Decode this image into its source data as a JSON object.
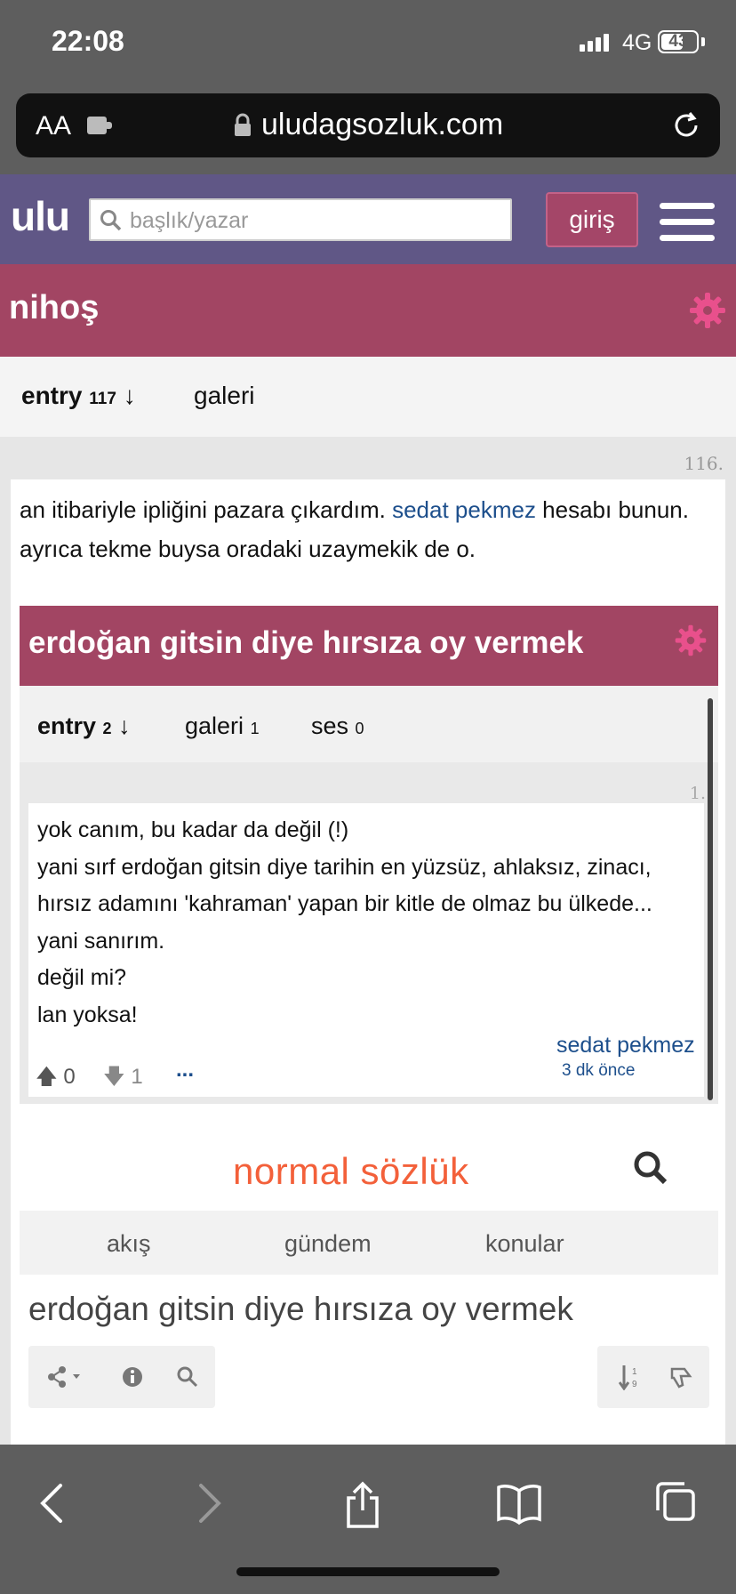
{
  "status_bar": {
    "time": "22:08",
    "network": "4G",
    "battery": "43"
  },
  "browser": {
    "text_size_label": "AA",
    "url": "uludagsozluk.com"
  },
  "site": {
    "logo": "ulu",
    "search_placeholder": "başlık/yazar",
    "login_label": "giriş"
  },
  "topic": {
    "title": "nihoş",
    "tabs": {
      "entry_label": "entry",
      "entry_count": "117",
      "sort_arrow": "↓",
      "gallery_label": "galeri"
    }
  },
  "entry": {
    "number": "116.",
    "text_before": "an itibariyle ipliğini pazara çıkardım. ",
    "link_text": "sedat pekmez",
    "text_after": " hesabı bunun. ayrıca tekme buysa oradaki uzaymekik de o."
  },
  "embedded_screenshot": {
    "title": "erdoğan gitsin diye hırsıza oy vermek",
    "tabs": {
      "entry_label": "entry",
      "entry_count": "2",
      "sort_arrow": "↓",
      "gallery_label": "galeri",
      "gallery_count": "1",
      "sound_label": "ses",
      "sound_count": "0"
    },
    "entry_number": "1.",
    "lines": [
      "yok canım, bu kadar da değil (!)",
      "yani sırf erdoğan gitsin diye tarihin en yüzsüz, ahlaksız, zinacı,",
      "hırsız adamını 'kahraman' yapan bir kitle de olmaz bu ülkede...",
      "yani sanırım.",
      "değil mi?",
      "lan yoksa!"
    ],
    "author": "sedat pekmez",
    "time": "3 dk önce",
    "upvotes": "0",
    "downvotes": "1",
    "more": "..."
  },
  "embedded_screenshot_2": {
    "logo": "normal sözlük",
    "nav": [
      "akış",
      "gündem",
      "konular"
    ],
    "title": "erdoğan gitsin diye hırsıza oy vermek"
  }
}
